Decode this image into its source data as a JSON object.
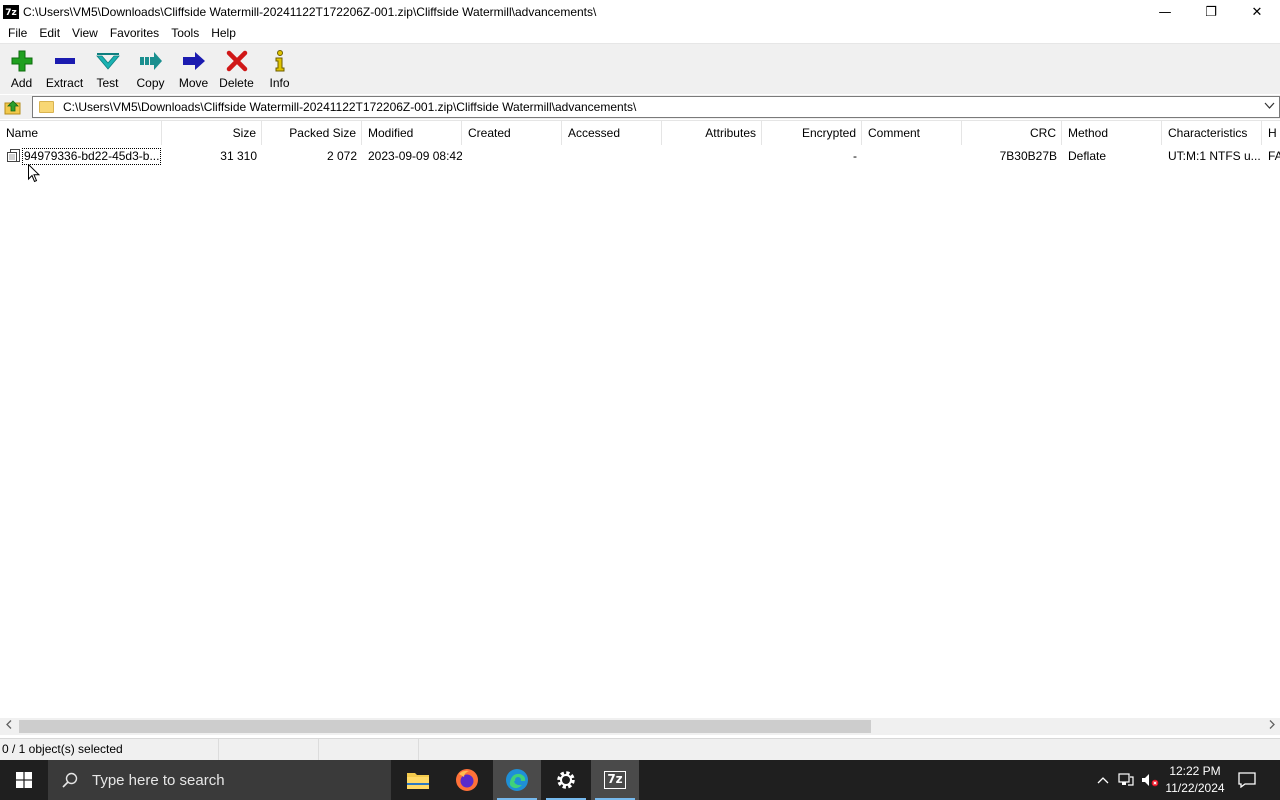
{
  "window": {
    "app_icon_text": "7z",
    "title": "C:\\Users\\VM5\\Downloads\\Cliffside Watermill-20241122T172206Z-001.zip\\Cliffside Watermill\\advancements\\",
    "minimize": "—",
    "restore": "❐",
    "close": "✕"
  },
  "menu": [
    "File",
    "Edit",
    "View",
    "Favorites",
    "Tools",
    "Help"
  ],
  "toolbar": [
    {
      "label": "Add",
      "icon": "add-icon",
      "color": "#1fa01f"
    },
    {
      "label": "Extract",
      "icon": "extract-icon",
      "color": "#1b1bb0"
    },
    {
      "label": "Test",
      "icon": "test-icon",
      "color": "#1ab2b2"
    },
    {
      "label": "Copy",
      "icon": "copy-icon",
      "color": "#1a8f8f"
    },
    {
      "label": "Move",
      "icon": "move-icon",
      "color": "#1b1bb0"
    },
    {
      "label": "Delete",
      "icon": "delete-icon",
      "color": "#d01818"
    },
    {
      "label": "Info",
      "icon": "info-icon",
      "color": "#b8a000"
    }
  ],
  "address": {
    "path": "C:\\Users\\VM5\\Downloads\\Cliffside Watermill-20241122T172206Z-001.zip\\Cliffside Watermill\\advancements\\"
  },
  "columns": [
    "Name",
    "Size",
    "Packed Size",
    "Modified",
    "Created",
    "Accessed",
    "Attributes",
    "Encrypted",
    "Comment",
    "CRC",
    "Method",
    "Characteristics",
    "H"
  ],
  "rows": [
    {
      "name": "94979336-bd22-45d3-b...",
      "size": "31 310",
      "packed_size": "2 072",
      "modified": "2023-09-09 08:42",
      "created": "",
      "accessed": "",
      "attributes": "",
      "encrypted": "-",
      "comment": "",
      "crc": "7B30B27B",
      "method": "Deflate",
      "characteristics": "UT:M:1 NTFS u...",
      "h": "FA"
    }
  ],
  "status": {
    "selection": "0 / 1 object(s) selected"
  },
  "taskbar": {
    "search_placeholder": "Type here to search",
    "time": "12:22 PM",
    "date": "11/22/2024",
    "apps": [
      "file-explorer-icon",
      "firefox-icon",
      "edge-icon",
      "settings-icon",
      "7zip-icon"
    ]
  }
}
